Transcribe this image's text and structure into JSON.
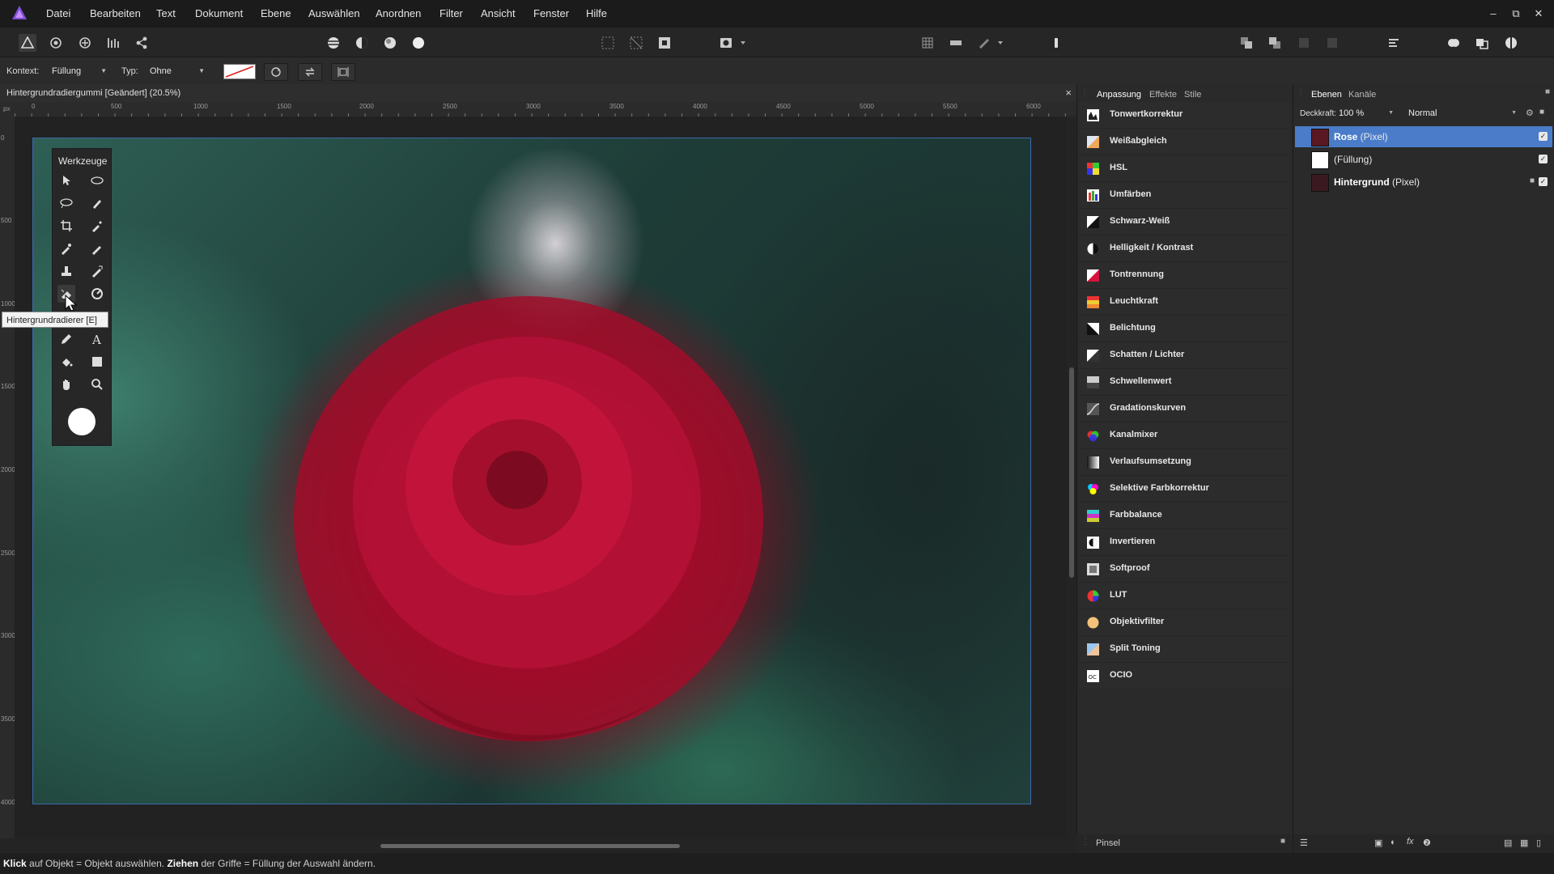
{
  "menu": [
    "Datei",
    "Bearbeiten",
    "Text",
    "Dokument",
    "Ebene",
    "Auswählen",
    "Anordnen",
    "Filter",
    "Ansicht",
    "Fenster",
    "Hilfe"
  ],
  "context": {
    "context_label": "Kontext:",
    "context_value": "Füllung",
    "type_label": "Typ:",
    "type_value": "Ohne"
  },
  "document": {
    "title": "Hintergrundradiergummi [Geändert] (20.5%)",
    "close": "×",
    "ruler_unit": "px",
    "ruler_h": [
      "0",
      "500",
      "1000",
      "1500",
      "2000",
      "2500",
      "3000",
      "3500",
      "4000",
      "4500",
      "5000",
      "5500",
      "6000"
    ],
    "ruler_v": [
      "0",
      "500",
      "1000",
      "1500",
      "2000",
      "2500",
      "3000",
      "3500",
      "4000"
    ]
  },
  "tools": {
    "title": "Werkzeuge",
    "tooltip": "Hintergrundradierer [E]"
  },
  "adjustments": {
    "tabs": [
      "Anpassung",
      "Effekte",
      "Stile"
    ],
    "items": [
      "Tonwertkorrektur",
      "Weißabgleich",
      "HSL",
      "Umfärben",
      "Schwarz-Weiß",
      "Helligkeit / Kontrast",
      "Tontrennung",
      "Leuchtkraft",
      "Belichtung",
      "Schatten / Lichter",
      "Schwellenwert",
      "Gradationskurven",
      "Kanalmixer",
      "Verlaufsumsetzung",
      "Selektive Farbkorrektur",
      "Farbbalance",
      "Invertieren",
      "Softproof",
      "LUT",
      "Objektivfilter",
      "Split Toning",
      "OCIO"
    ],
    "bottom_label": "Pinsel"
  },
  "layers": {
    "tabs": [
      "Ebenen",
      "Kanäle"
    ],
    "opacity_label": "Deckkraft:",
    "opacity_value": "100 %",
    "blend_mode": "Normal",
    "rows": [
      {
        "name": "Rose",
        "type": " (Pixel)"
      },
      {
        "name": "",
        "type": "(Füllung)"
      },
      {
        "name": "Hintergrund",
        "type": " (Pixel)"
      }
    ]
  },
  "status": {
    "part1_bold": "Klick",
    "part1": " auf Objekt = Objekt auswählen. ",
    "part2_bold": "Ziehen",
    "part2": " der Griffe = Füllung der Auswahl ändern."
  },
  "colors": {
    "accent": "#4a7cc9",
    "selection": "#3b6aa8"
  }
}
